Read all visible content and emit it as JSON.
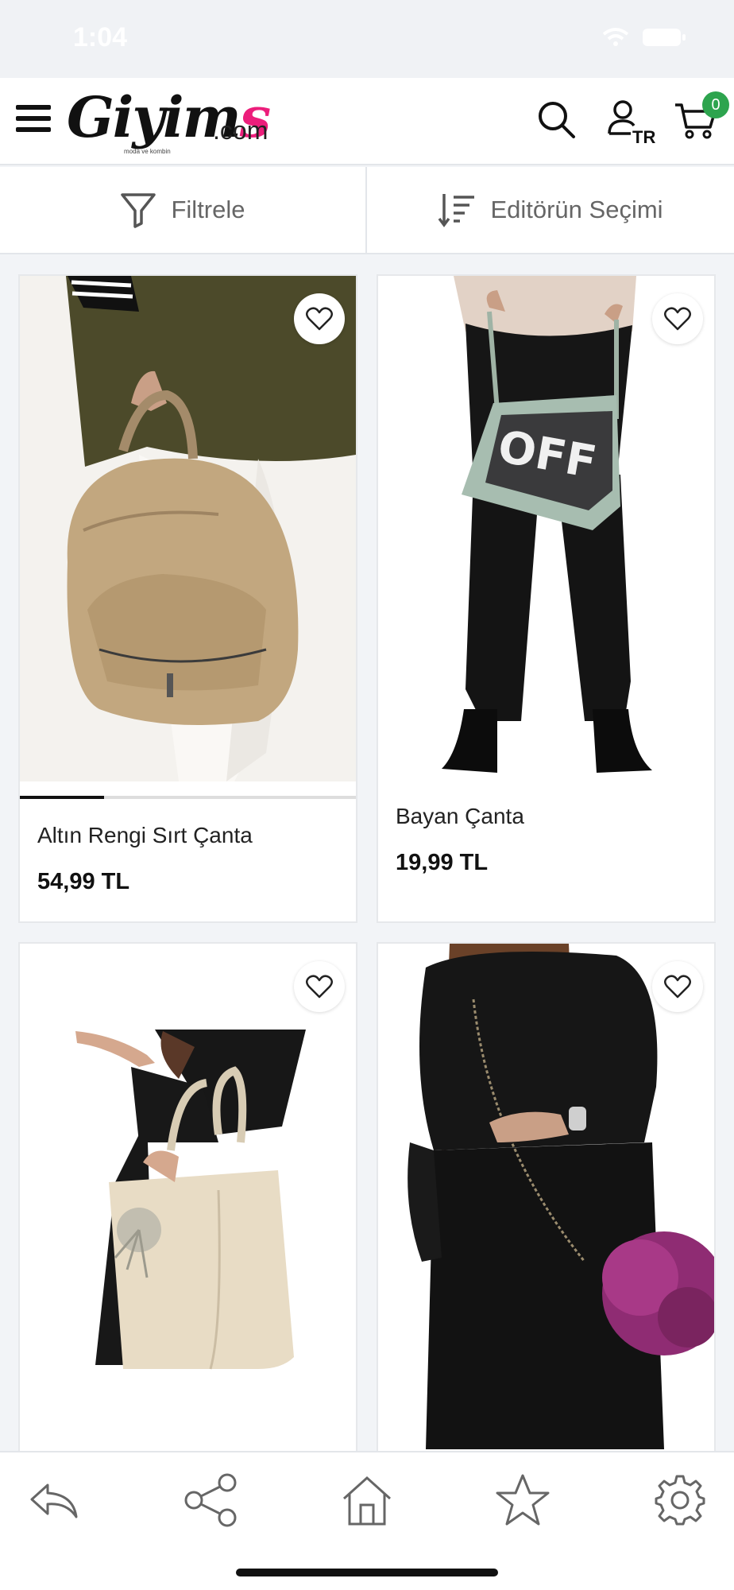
{
  "status": {
    "time": "1:04"
  },
  "header": {
    "logo_text": "Giyim",
    "logo_s": "s",
    "logo_domain": ".com",
    "logo_tagline": "moda ve kombin",
    "cart_count": "0",
    "language": "TR"
  },
  "filter": {
    "filter_label": "Filtrele",
    "sort_label": "Editörün Seçimi"
  },
  "products": [
    {
      "name": "Altın Rengi Sırt Çanta",
      "price": "54,99 TL",
      "image_progress": 0.25
    },
    {
      "name": "Bayan Çanta",
      "price": "19,99 TL"
    },
    {
      "name": "",
      "price": ""
    },
    {
      "name": "",
      "price": ""
    }
  ],
  "product_images": {
    "bag2_text": "OFF"
  },
  "colors": {
    "brand_pink": "#ec1e7b",
    "badge_green": "#2da44e",
    "background": "#f2f4f7"
  },
  "tabbar": {
    "icons": [
      "reply-icon",
      "share-icon",
      "home-icon",
      "star-icon",
      "gear-icon"
    ]
  }
}
